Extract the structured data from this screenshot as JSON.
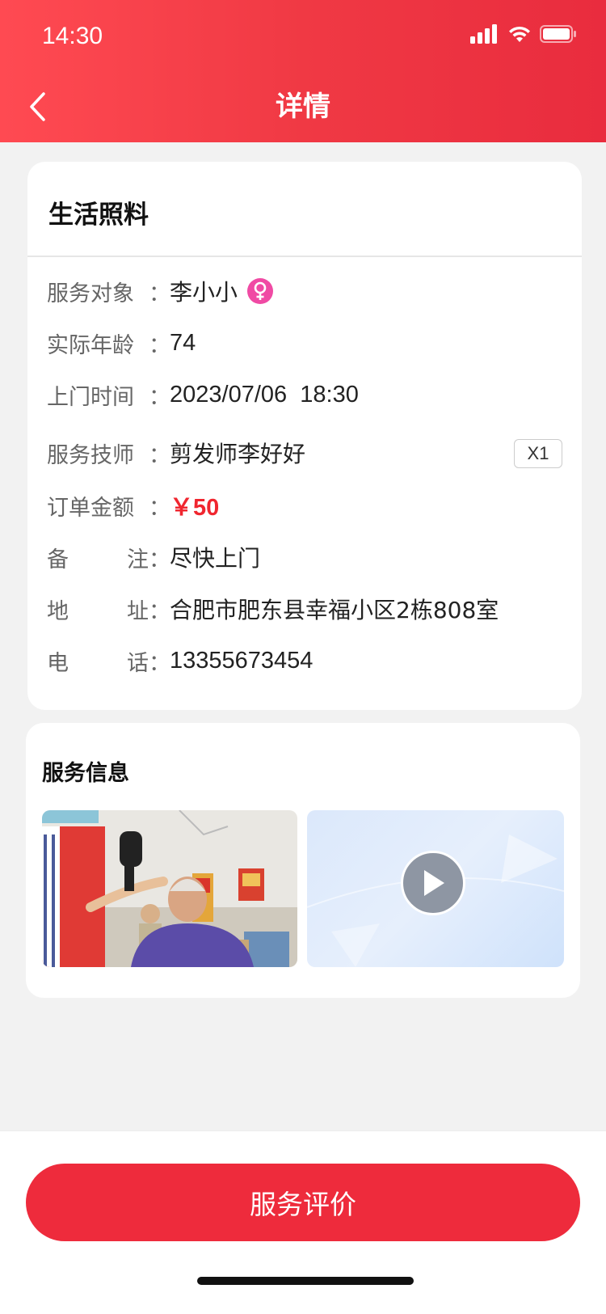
{
  "status_bar": {
    "time": "14:30"
  },
  "header": {
    "title": "详情"
  },
  "order": {
    "service_name": "生活照料",
    "rows": {
      "client": {
        "label": "服务对象",
        "value": "李小小"
      },
      "age": {
        "label": "实际年龄",
        "value": "74"
      },
      "visit_time": {
        "label": "上门时间",
        "value": "2023/07/06  18:30"
      },
      "technician": {
        "label": "服务技师",
        "value": "剪发师李好好",
        "quantity": "X1"
      },
      "amount": {
        "label": "订单金额",
        "value": "￥50"
      },
      "remark": {
        "label_a": "备",
        "label_b": "注",
        "value": "尽快上门"
      },
      "address": {
        "label_a": "地",
        "label_b": "址",
        "value": "合肥市肥东县幸福小区2栋808室"
      },
      "phone": {
        "label_a": "电",
        "label_b": "话",
        "value": "13355673454"
      }
    },
    "colon": "："
  },
  "service_info": {
    "title": "服务信息"
  },
  "bottom": {
    "review_button": "服务评价"
  },
  "colors": {
    "accent": "#ee2b3c",
    "price": "#f0262f",
    "female_badge": "#f04aa4"
  },
  "icons": {
    "back": "chevron-left-icon",
    "gender": "female-icon",
    "play": "play-icon"
  }
}
